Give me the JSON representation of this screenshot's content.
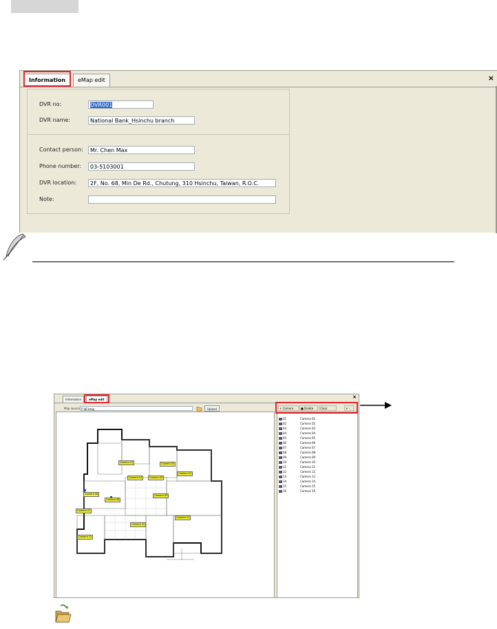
{
  "info_panel": {
    "tabs": [
      "Information",
      "eMap edit"
    ],
    "close_glyph": "×",
    "fields": [
      {
        "label": "DVR no:",
        "value": "DVR001"
      },
      {
        "label": "DVR name:",
        "value": "National Bank_Hsinchu branch"
      },
      {
        "label": "Contact person:",
        "value": "Mr. Chen Max"
      },
      {
        "label": "Phone number:",
        "value": "03-5103001"
      },
      {
        "label": "DVR location:",
        "value": "2F, No. 68, Min De Rd., Chutung, 310 Hsinchu, Taiwan, R.O.C."
      },
      {
        "label": "Note:",
        "value": ""
      }
    ]
  },
  "emap_panel": {
    "tabs": [
      "Information",
      "eMap edit"
    ],
    "close_glyph": "×",
    "map_source_label": "Map source:",
    "map_source_value": "F:\\6F.bmp",
    "upload_label": "Upload",
    "toolbar": [
      "+ Camera",
      "■ Delete",
      "Clear",
      "+  -"
    ],
    "cameras": [
      {
        "num": "01",
        "name": "Camera 01"
      },
      {
        "num": "02",
        "name": "Camera 02"
      },
      {
        "num": "03",
        "name": "Camera 03"
      },
      {
        "num": "04",
        "name": "Camera 04"
      },
      {
        "num": "05",
        "name": "Camera 05"
      },
      {
        "num": "06",
        "name": "Camera 06"
      },
      {
        "num": "07",
        "name": "Camera 07"
      },
      {
        "num": "08",
        "name": "Camera 08"
      },
      {
        "num": "09",
        "name": "Camera 09"
      },
      {
        "num": "10",
        "name": "Camera 10"
      },
      {
        "num": "11",
        "name": "Camera 11"
      },
      {
        "num": "12",
        "name": "Camera 12"
      },
      {
        "num": "13",
        "name": "Camera 13"
      },
      {
        "num": "14",
        "name": "Camera 14"
      },
      {
        "num": "15",
        "name": "Camera 15"
      },
      {
        "num": "16",
        "name": "Camera 16"
      }
    ],
    "map_tags": [
      "Camera 01",
      "Camera 02",
      "Camera 03",
      "Camera 04",
      "Camera 05",
      "Camera 06",
      "Camera 07",
      "Camera 08",
      "Camera 09",
      "Camera 10",
      "Camera 11",
      "Camera 12"
    ]
  },
  "colors": {
    "highlight": "#e8202a",
    "panel": "#ece9d8",
    "selection": "#316ac5"
  },
  "icons": [
    "feather-note-icon",
    "open-folder-icon",
    "arrow-right-icon",
    "close-icon"
  ]
}
